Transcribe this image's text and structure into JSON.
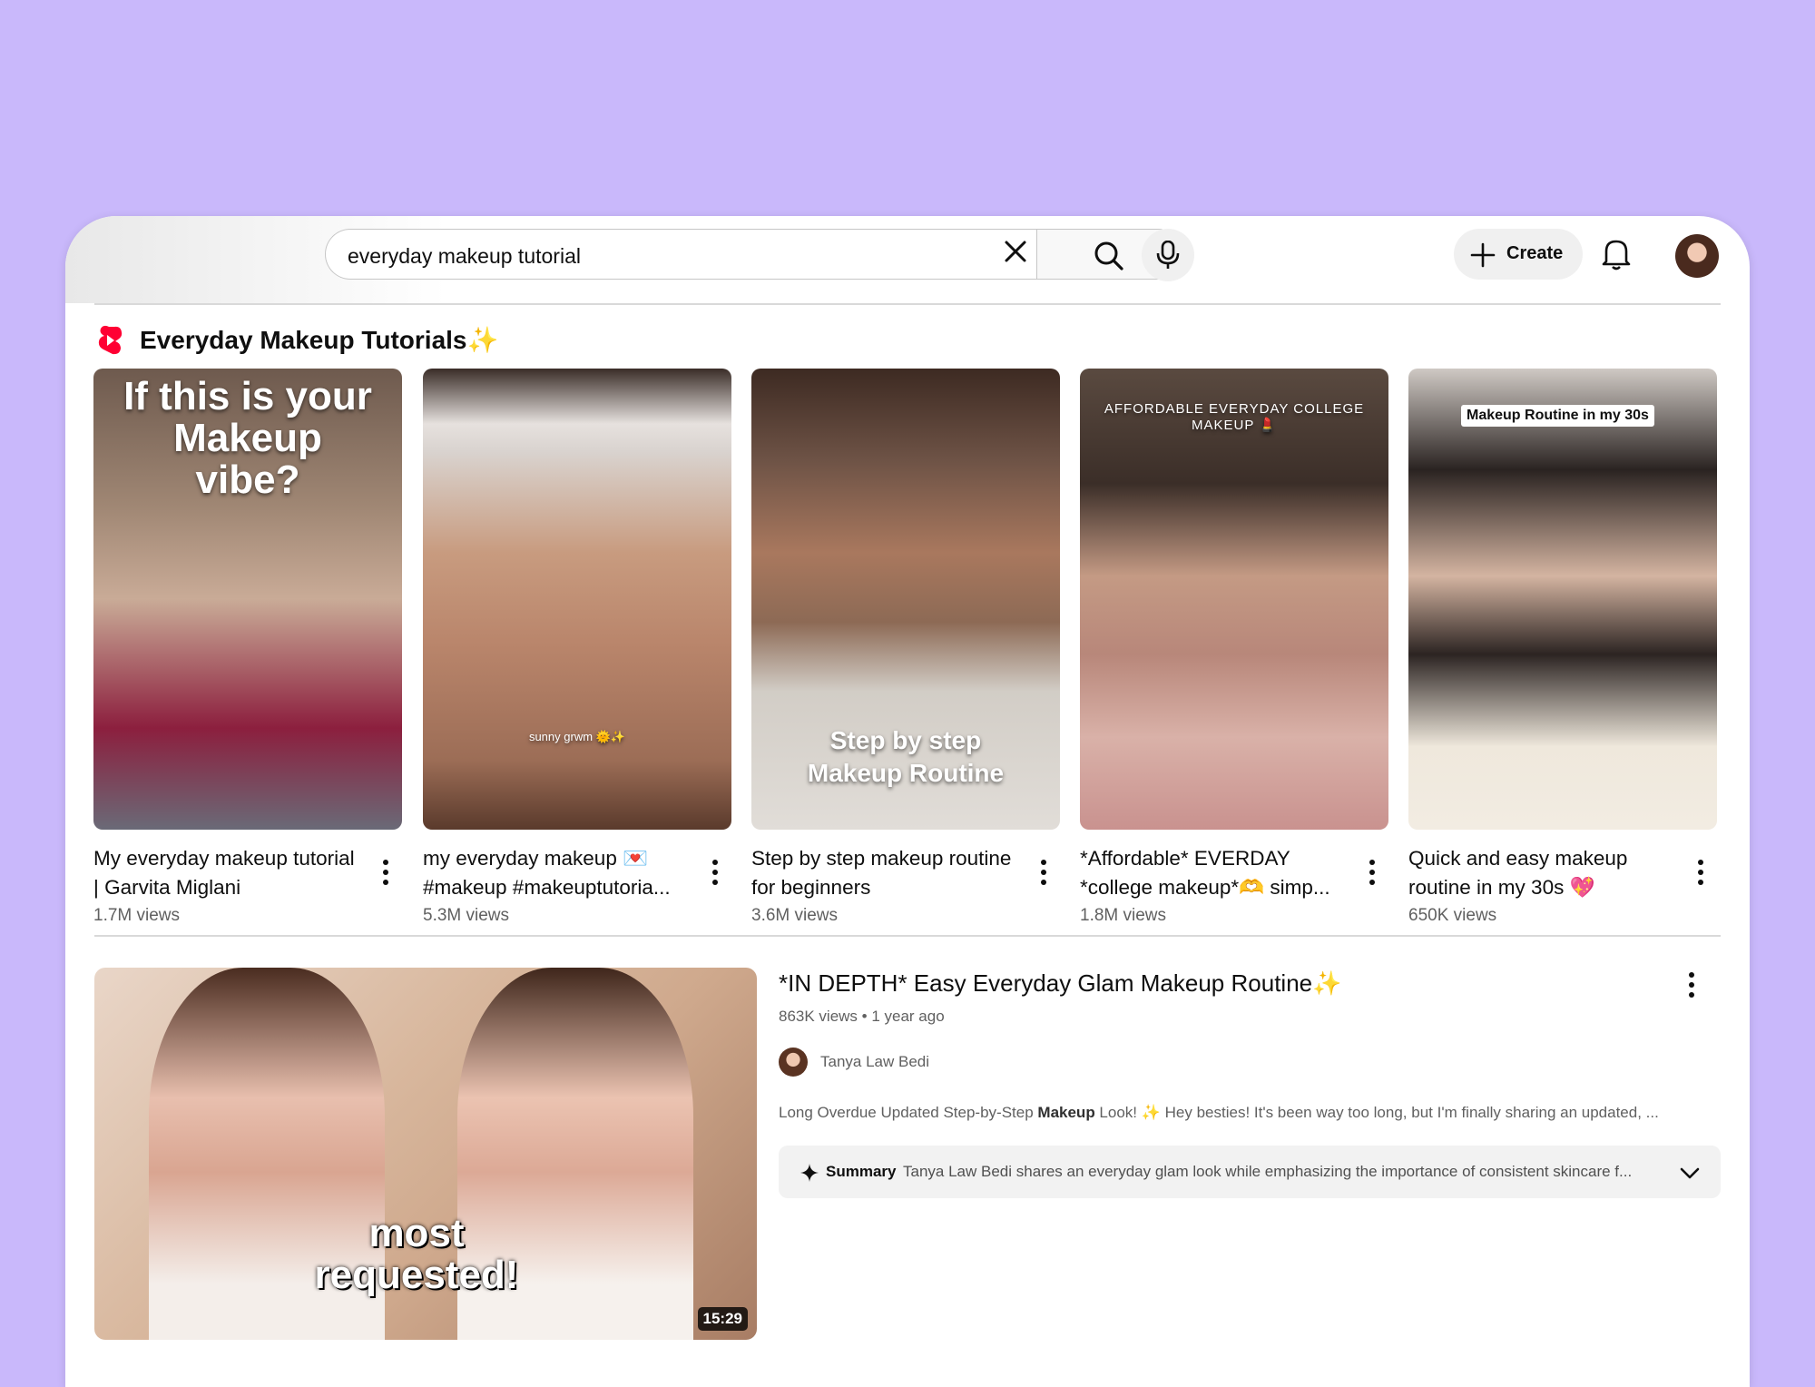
{
  "search": {
    "query": "everyday makeup tutorial",
    "clear_icon": "close-icon",
    "search_icon": "search-icon",
    "mic_icon": "microphone-icon"
  },
  "header": {
    "create_label": "Create",
    "create_icon": "plus-icon",
    "notifications_icon": "bell-icon",
    "avatar": "user-avatar"
  },
  "shelf": {
    "icon": "shorts-logo-icon",
    "title": "Everyday Makeup Tutorials✨",
    "items": [
      {
        "title": "My everyday makeup tutorial | Garvita Miglani",
        "views": "1.7M views",
        "overlay": "If this is your Makeup vibe?"
      },
      {
        "title": "my everyday makeup 💌 #makeup #makeuptutoria...",
        "views": "5.3M views",
        "overlay": "sunny grwm 🌞✨"
      },
      {
        "title": "Step by step makeup routine for beginners",
        "views": "3.6M views",
        "overlay": "Step by step Makeup Routine"
      },
      {
        "title": "*Affordable* EVERDAY *college makeup*🫶 simp...",
        "views": "1.8M views",
        "overlay": "AFFORDABLE EVERYDAY COLLEGE MAKEUP 💄"
      },
      {
        "title": "Quick and easy makeup routine in my 30s 💖",
        "views": "650K views",
        "overlay": "Makeup Routine in my 30s"
      }
    ]
  },
  "video": {
    "title": "*IN DEPTH* Easy Everyday Glam Makeup Routine✨",
    "meta": "863K views • 1 year ago",
    "channel": "Tanya Law Bedi",
    "snippet_before": "Long Overdue Updated Step-by-Step ",
    "snippet_bold": "Makeup",
    "snippet_after": " Look! ✨ Hey besties! It's been way too long, but I'm finally sharing an updated, ...",
    "summary_label": "Summary",
    "summary_text": "Tanya Law Bedi shares an everyday glam look while emphasizing the importance of consistent skincare f...",
    "thumbnail_text": "most requested!",
    "duration": "15:29"
  },
  "colors": {
    "background": "#c9b8fb",
    "shorts_red": "#ff0033"
  }
}
